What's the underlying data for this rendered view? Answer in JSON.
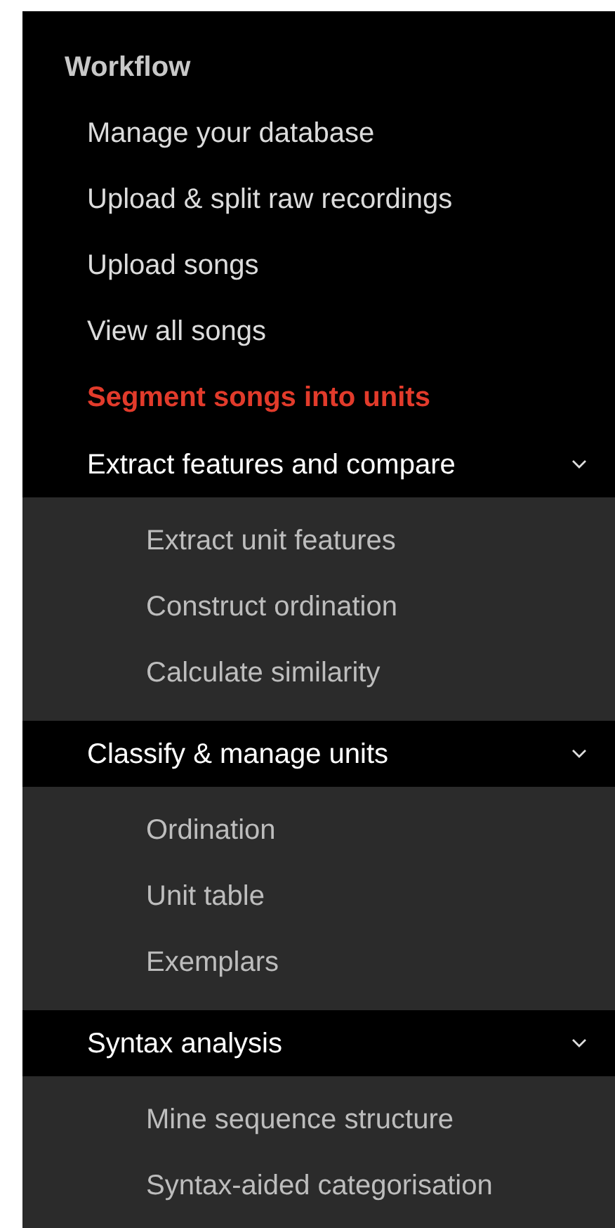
{
  "sidebar": {
    "title": "Workflow",
    "items": [
      {
        "kind": "link",
        "label": "Manage your database",
        "selected": false
      },
      {
        "kind": "link",
        "label": "Upload & split raw recordings",
        "selected": false
      },
      {
        "kind": "link",
        "label": "Upload songs",
        "selected": false
      },
      {
        "kind": "link",
        "label": "View all songs",
        "selected": false
      },
      {
        "kind": "link",
        "label": "Segment songs into units",
        "selected": true
      },
      {
        "kind": "group",
        "label": "Extract features and compare",
        "expanded": true,
        "children": [
          {
            "label": "Extract unit features",
            "selected": false
          },
          {
            "label": "Construct ordination",
            "selected": false
          },
          {
            "label": "Calculate similarity",
            "selected": false
          }
        ]
      },
      {
        "kind": "group",
        "label": "Classify & manage units",
        "expanded": true,
        "children": [
          {
            "label": "Ordination",
            "selected": false
          },
          {
            "label": "Unit table",
            "selected": false
          },
          {
            "label": "Exemplars",
            "selected": false
          }
        ]
      },
      {
        "kind": "group",
        "label": "Syntax analysis",
        "expanded": true,
        "children": [
          {
            "label": "Mine sequence structure",
            "selected": false
          },
          {
            "label": "Syntax-aided categorisation",
            "selected": false
          }
        ]
      }
    ]
  }
}
